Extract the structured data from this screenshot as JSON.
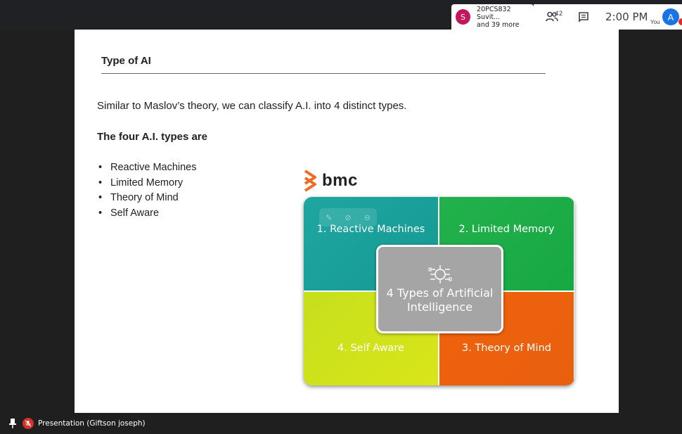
{
  "top_bar": {
    "participant_initial": "S",
    "participant_line1": "20PCS832 Suvit...",
    "participant_line2": "and 39 more",
    "people_count": "42",
    "clock": "2:00 PM",
    "self_label": "You",
    "self_initial": "A",
    "icons": [
      "people-icon",
      "chat-icon"
    ],
    "colors": {
      "participant_avatar": "#c2185b",
      "self_avatar": "#1a73e8",
      "notification": "#d93025"
    }
  },
  "slide": {
    "title": "Type of AI",
    "intro": "Similar to Maslov’s theory, we can classify A.I. into 4 distinct types.",
    "heading": "The four A.I. types are",
    "types": [
      "Reactive Machines",
      "Limited Memory",
      "Theory of Mind",
      "Self Aware"
    ],
    "bullet": "•",
    "logo_text": "bmc",
    "diagram": {
      "q1": "1. Reactive Machines",
      "q2": "2. Limited Memory",
      "q3": "3. Theory of Mind",
      "q4": "4. Self Aware",
      "center": "4 Types of Artificial Intelligence",
      "colors": {
        "q1": "#1fa6a1",
        "q2": "#22b14c",
        "q3": "#f0620c",
        "q4": "#c6e01c",
        "center": "#a5a5a5"
      }
    }
  },
  "bottom_bar": {
    "presenter": "Presentation (Giftson joseph)"
  }
}
